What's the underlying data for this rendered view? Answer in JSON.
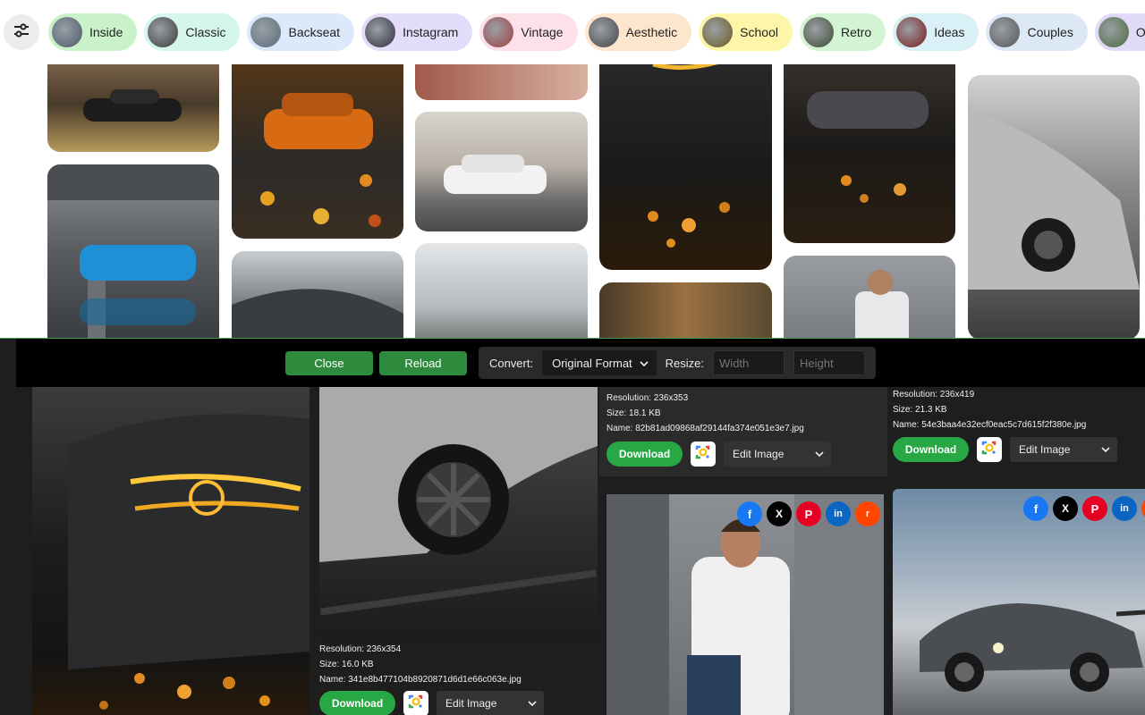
{
  "chips": [
    {
      "label": "Inside",
      "bg": "#c9f2c9",
      "thumb": "#4a5a6a"
    },
    {
      "label": "Classic",
      "bg": "#d4f6ec",
      "thumb": "#3a3a3a"
    },
    {
      "label": "Backseat",
      "bg": "#dbe9fb",
      "thumb": "#5b6b7a"
    },
    {
      "label": "Instagram",
      "bg": "#e3dcfb",
      "thumb": "#2e2e3a"
    },
    {
      "label": "Vintage",
      "bg": "#fde0ea",
      "thumb": "#a04040"
    },
    {
      "label": "Aesthetic",
      "bg": "#fde6cc",
      "thumb": "#444"
    },
    {
      "label": "School",
      "bg": "#fdf6a8",
      "thumb": "#6a5a20"
    },
    {
      "label": "Retro",
      "bg": "#d3f5d3",
      "thumb": "#3d4a30"
    },
    {
      "label": "Ideas",
      "bg": "#d8f0f6",
      "thumb": "#7a1a1a"
    },
    {
      "label": "Couples",
      "bg": "#dde8f6",
      "thumb": "#555"
    },
    {
      "label": "Old",
      "bg": "#e0daf8",
      "thumb": "#4a6a3a"
    },
    {
      "label": "",
      "bg": "#fde0ea",
      "thumb": "#2a2a2a"
    }
  ],
  "toolbar": {
    "close_label": "Close",
    "reload_label": "Reload",
    "convert_label": "Convert:",
    "format_value": "Original Format",
    "resize_label": "Resize:",
    "width_placeholder": "Width",
    "height_placeholder": "Height"
  },
  "cards": [
    {
      "resolution": "Resolution: 236x354",
      "size": "Size: 16.0 KB",
      "name": "Name: 341e8b477104b8920871d6d1e66c063e.jpg",
      "download": "Download",
      "edit": "Edit Image"
    },
    {
      "resolution": "Resolution: 236x353",
      "size": "Size: 18.1 KB",
      "name": "Name: 82b81ad09868af29144fa374e051e3e7.jpg",
      "download": "Download",
      "edit": "Edit Image"
    },
    {
      "resolution": "Resolution: 236x419",
      "size": "Size: 21.3 KB",
      "name": "Name: 54e3baa4e32ecf0eac5c7d615f2f380e.jpg",
      "download": "Download",
      "edit": "Edit Image"
    }
  ],
  "share_icons": [
    "facebook-icon",
    "x-icon",
    "pinterest-icon",
    "linkedin-icon",
    "reddit-icon"
  ],
  "colors": {
    "accent_green": "#28a745",
    "panel_bg": "#1e1e1e",
    "facebook": "#1877f2",
    "x": "#000000",
    "pinterest": "#e60023",
    "linkedin": "#0a66c2",
    "reddit": "#ff4500"
  }
}
